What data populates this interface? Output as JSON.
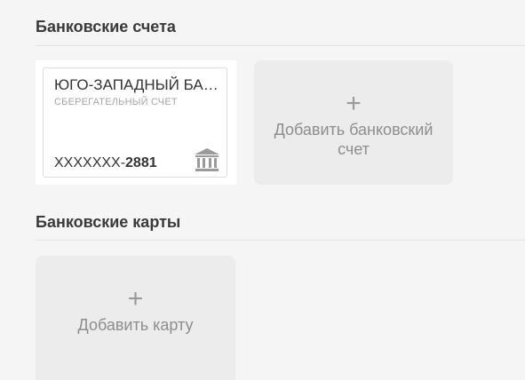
{
  "accounts_section": {
    "title": "Банковские счета",
    "account": {
      "bank_name": "ЮГО-ЗАПАДНЫЙ БАНК",
      "account_type": "СБЕРЕГАТЕЛЬНЫЙ СЧЕТ",
      "number_mask": "XXXXXXX-",
      "number_last4": "2881",
      "icon": "bank-icon"
    },
    "add_label": "Добавить банковский счет",
    "add_icon": "+"
  },
  "cards_section": {
    "title": "Банковские карты",
    "add_label": "Добавить карту",
    "add_icon": "+"
  }
}
